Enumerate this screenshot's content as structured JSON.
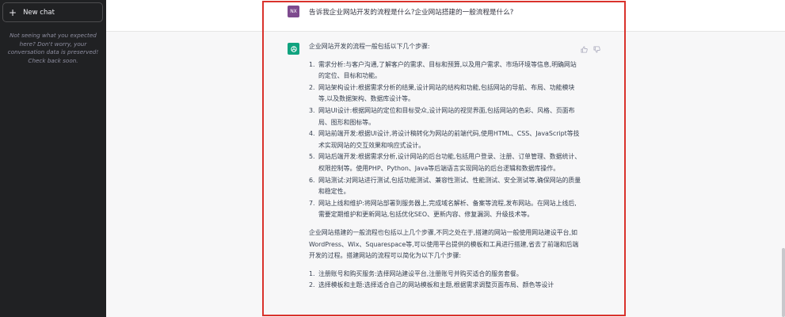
{
  "sidebar": {
    "new_chat_label": "New chat",
    "note": "Not seeing what you expected here? Don't worry, your conversation data is preserved! Check back soon."
  },
  "user": {
    "avatar": "NX",
    "message": "告诉我企业网站开发的流程是什么?企业网站搭建的一般流程是什么?"
  },
  "assistant": {
    "intro": "企业网站开发的流程一般包括以下几个步骤:",
    "steps": [
      {
        "num": "1.",
        "text": "需求分析:与客户沟通,了解客户的需求、目标和预算,以及用户需求、市场环境等信息,明确网站的定位、目标和功能。"
      },
      {
        "num": "2.",
        "text": "网站架构设计:根据需求分析的结果,设计网站的结构和功能,包括网站的导航、布局、功能模块等,以及数据架构、数据库设计等。"
      },
      {
        "num": "3.",
        "text": "网站UI设计:根据网站的定位和目标受众,设计网站的视觉界面,包括网站的色彩、风格、页面布局、图形和图标等。"
      },
      {
        "num": "4.",
        "text": "网站前端开发:根据UI设计,将设计稿转化为网站的前端代码,使用HTML、CSS、JavaScript等技术实现网站的交互效果和响应式设计。"
      },
      {
        "num": "5.",
        "text": "网站后端开发:根据需求分析,设计网站的后台功能,包括用户登录、注册、订单管理、数据统计、权限控制等。使用PHP、Python、Java等后端语言实现网站的后台逻辑和数据库操作。"
      },
      {
        "num": "6.",
        "text": "网站测试:对网站进行测试,包括功能测试、兼容性测试、性能测试、安全测试等,确保网站的质量和稳定性。"
      },
      {
        "num": "7.",
        "text": "网站上线和维护:将网站部署到服务器上,完成域名解析、备案等流程,发布网站。在网站上线后,需要定期维护和更新网站,包括优化SEO、更新内容、修复漏洞、升级技术等。"
      }
    ],
    "paragraph2": "企业网站搭建的一般流程也包括以上几个步骤,不同之处在于,搭建的网站一般使用网站建设平台,如WordPress、Wix、Squarespace等,可以使用平台提供的模板和工具进行搭建,省去了前端和后端开发的过程。搭建网站的流程可以简化为以下几个步骤:",
    "steps2": [
      {
        "num": "1.",
        "text": "注册账号和购买服务:选择网站建设平台,注册账号并购买适合的服务套餐。"
      },
      {
        "num": "2.",
        "text": "选择模板和主题:选择适合自己的网站模板和主题,根据需求调整页面布局、颜色等设计"
      }
    ]
  },
  "colors": {
    "sidebar_bg": "#202123",
    "assistant_bg": "#f7f7f8",
    "bot_avatar": "#10a37f",
    "user_avatar": "#7d4a8e",
    "highlight_border": "#d9322c"
  }
}
